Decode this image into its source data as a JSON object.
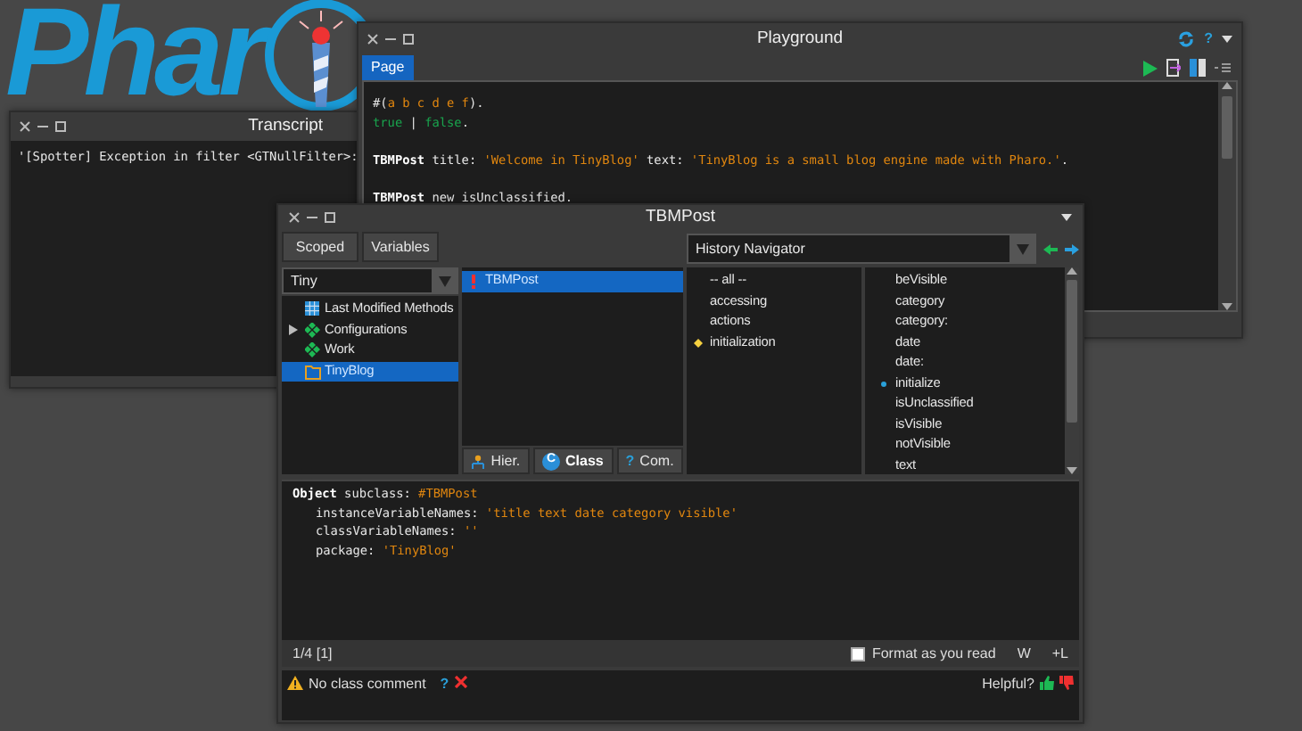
{
  "logo": {
    "text": "Phar"
  },
  "transcript": {
    "title": "Transcript",
    "lines": [
      "'[Spotter] Exception in filter <GTNullFilter>:"
    ]
  },
  "playground": {
    "title": "Playground",
    "help": "?",
    "tabs": [
      {
        "label": "Page",
        "selected": true
      }
    ],
    "code_blocks": [
      {
        "lines": [
          {
            "tokens": [
              {
                "text": "#(",
                "kind": "plain"
              },
              {
                "text": "a b c d e f",
                "kind": "literal"
              },
              {
                "text": ").",
                "kind": "plain"
              }
            ]
          },
          {
            "tokens": [
              {
                "text": "true",
                "kind": "boolean"
              },
              {
                "text": " | ",
                "kind": "plain"
              },
              {
                "text": "false",
                "kind": "boolean"
              },
              {
                "text": ".",
                "kind": "plain"
              }
            ]
          }
        ]
      },
      {
        "lines": [
          {
            "tokens": [
              {
                "text": "TBMPost",
                "kind": "class"
              },
              {
                "text": " title: ",
                "kind": "plain"
              },
              {
                "text": "'Welcome in TinyBlog'",
                "kind": "literal"
              },
              {
                "text": " text: ",
                "kind": "plain"
              },
              {
                "text": "'TinyBlog is a small blog engine made with Pharo.'",
                "kind": "literal"
              },
              {
                "text": ".",
                "kind": "plain"
              }
            ]
          }
        ]
      },
      {
        "lines": [
          {
            "tokens": [
              {
                "text": "TBMPost",
                "kind": "class"
              },
              {
                "text": " new isUnclassified.",
                "kind": "plain"
              }
            ]
          }
        ]
      }
    ]
  },
  "browser": {
    "title": "TBMPost",
    "scope_buttons": [
      {
        "label": "Scoped"
      },
      {
        "label": "Variables"
      }
    ],
    "history": {
      "value": "History Navigator"
    },
    "package_filter": {
      "value": "Tiny"
    },
    "packages": [
      {
        "label": "Last Modified Methods",
        "kind": "recent",
        "expandable": false,
        "selected": false
      },
      {
        "label": "Configurations",
        "kind": "package",
        "expandable": true,
        "selected": false
      },
      {
        "label": "Work",
        "kind": "package",
        "expandable": false,
        "selected": false
      },
      {
        "label": "TinyBlog",
        "kind": "folder",
        "expandable": false,
        "selected": true
      }
    ],
    "classes": [
      {
        "label": "TBMPost",
        "flagged": true,
        "selected": true
      }
    ],
    "class_buttons": [
      {
        "label": "Hier.",
        "kind": "hierarchy",
        "selected": false
      },
      {
        "label": "Class",
        "kind": "class",
        "glyph": "C",
        "selected": true
      },
      {
        "label": "Com.",
        "kind": "comment",
        "glyph": "?",
        "selected": false
      }
    ],
    "protocols": [
      {
        "label": "-- all --",
        "marked": false
      },
      {
        "label": "accessing",
        "marked": false
      },
      {
        "label": "actions",
        "marked": false
      },
      {
        "label": "initialization",
        "marked": true
      }
    ],
    "methods": [
      {
        "label": "beVisible",
        "marked": false
      },
      {
        "label": "category",
        "marked": false
      },
      {
        "label": "category:",
        "marked": false
      },
      {
        "label": "date",
        "marked": false
      },
      {
        "label": "date:",
        "marked": false
      },
      {
        "label": "initialize",
        "marked": true
      },
      {
        "label": "isUnclassified",
        "marked": false
      },
      {
        "label": "isVisible",
        "marked": false
      },
      {
        "label": "notVisible",
        "marked": false
      },
      {
        "label": "text",
        "marked": false
      }
    ],
    "definition": [
      {
        "indented": false,
        "tokens": [
          {
            "text": "Object",
            "kind": "class"
          },
          {
            "text": " subclass: ",
            "kind": "plain"
          },
          {
            "text": "#TBMPost",
            "kind": "literal"
          }
        ]
      },
      {
        "indented": true,
        "tokens": [
          {
            "text": "instanceVariableNames: ",
            "kind": "plain"
          },
          {
            "text": "'title text date category visible'",
            "kind": "literal"
          }
        ]
      },
      {
        "indented": true,
        "tokens": [
          {
            "text": "classVariableNames: ",
            "kind": "plain"
          },
          {
            "text": "''",
            "kind": "literal"
          }
        ]
      },
      {
        "indented": true,
        "tokens": [
          {
            "text": "package: ",
            "kind": "plain"
          },
          {
            "text": "'TinyBlog'",
            "kind": "literal"
          }
        ]
      }
    ],
    "status": {
      "position": "1/4 [1]",
      "format": {
        "label": "Format as you read",
        "checked": false
      },
      "wrap": "W",
      "lines": "+L"
    },
    "comment": {
      "message": "No class comment",
      "help": "?",
      "helpful": "Helpful?"
    }
  }
}
